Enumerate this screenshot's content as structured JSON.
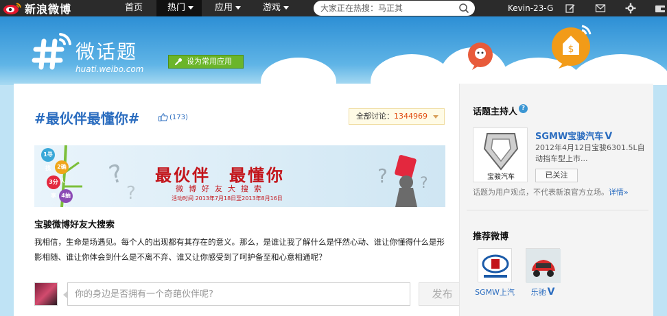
{
  "topnav": {
    "logo": "新浪微博",
    "items": [
      {
        "label": "首页",
        "has_caret": false,
        "active": false
      },
      {
        "label": "热门",
        "has_caret": true,
        "active": true
      },
      {
        "label": "应用",
        "has_caret": true,
        "active": false
      },
      {
        "label": "游戏",
        "has_caret": true,
        "active": false
      }
    ],
    "search": {
      "placeholder": "大家正在热搜：马正其",
      "icon": "search-icon"
    },
    "user": "Kevin-23-G",
    "icons": [
      "edit-icon",
      "mail-icon",
      "gear-icon",
      "wallet-icon"
    ]
  },
  "header": {
    "title": "微话题",
    "domain": "huati.weibo.com",
    "set_app_button": "设为常用应用"
  },
  "topic": {
    "title": "#最伙伴最懂你#",
    "likes": "(173)",
    "discuss_label": "全部讨论：",
    "discuss_count": "1344969"
  },
  "promo": {
    "headline": "最伙伴　最懂你",
    "subtitle": "微博好友大搜索",
    "date_text": "活动时间 2013年7月18日至2013年8月16日",
    "steps": [
      "1寻找",
      "2确认",
      "3分享",
      "4抽奖"
    ]
  },
  "content": {
    "section_title": "宝骏微博好友大搜索",
    "description": "我相信，生命是场遇见。每个人的出现都有其存在的意义。那么，是谁让我了解什么是怦然心动、谁让你懂得什么是形影相随、谁让你体会到什么是不离不弃、谁又让你感受到了呵护备至和心意相通呢？",
    "composer_placeholder": "你的身边是否拥有一个奇葩伙伴呢?",
    "post_button": "发布"
  },
  "sidebar": {
    "host_heading": "话题主持人",
    "host": {
      "name": "SGMW宝骏汽车",
      "desc": "2012年4月12日宝骏6301.5L自动挡车型上市...",
      "follow_label": "已关注",
      "logo_text": "宝骏汽车"
    },
    "disclaimer": "话题为用户观点，不代表新浪官方立场。",
    "detail_link": "详情»",
    "recommend_heading": "推荐微博",
    "recommend": [
      {
        "name": "SGMW上汽",
        "verified": false
      },
      {
        "name": "乐驰",
        "verified": true
      }
    ]
  },
  "colors": {
    "accent_blue": "#2a6cbf",
    "count_orange": "#e04b10",
    "promo_red": "#c3141a",
    "app_green": "#6bb52a"
  }
}
